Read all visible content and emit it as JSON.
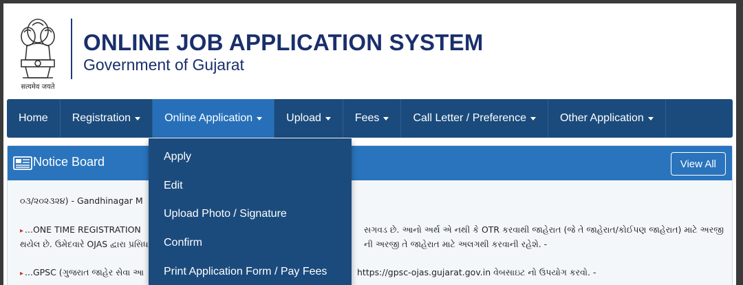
{
  "header": {
    "emblem_caption": "सत्यमेव जयते",
    "title": "ONLINE JOB APPLICATION SYSTEM",
    "subtitle": "Government of Gujarat"
  },
  "nav": {
    "items": [
      {
        "label": "Home"
      },
      {
        "label": "Registration"
      },
      {
        "label": "Online Application"
      },
      {
        "label": "Upload"
      },
      {
        "label": "Fees"
      },
      {
        "label": "Call Letter / Preference"
      },
      {
        "label": "Other Application"
      }
    ],
    "active": "Online Application"
  },
  "dropdown": {
    "items": [
      {
        "label": "Apply"
      },
      {
        "label": "Edit"
      },
      {
        "label": "Upload Photo / Signature"
      },
      {
        "label": "Confirm"
      },
      {
        "label": "Print Application Form / Pay Fees"
      }
    ]
  },
  "notice_board": {
    "title": "Notice Board",
    "view_all": "View All",
    "notices": [
      {
        "text": "૦૩/૨૦૨૩૨૪) - Gandhinagar M"
      },
      {
        "text": "...ONE TIME REGISTRATION",
        "text_right": "સગવડ છે. આનો અર્થ એ નથી કે OTR કરવાથી જાહેરાત (જે તે જાહેરાત/કોઈપણ જાહેરાત) માટે અરજી"
      },
      {
        "text": "થયેલ છે. ઉમેદવારે OJAS દ્વારા પ્રસિધ",
        "text_right": "ની અરજી તે જાહેરાત માટે અલગથી કરવાની રહેશે. -"
      },
      {
        "text": "...GPSC (ગુજરાત જાહેર સેવા આ",
        "text_right": "https://gpsc-ojas.gujarat.gov.in વેબસાઇટ નો ઉપયોગ કરવો. -"
      }
    ]
  },
  "colors": {
    "navbar": "#1b4b7d",
    "nav_active": "#2770b9",
    "notice_header": "#2a74bd",
    "title": "#1a2f6b"
  }
}
